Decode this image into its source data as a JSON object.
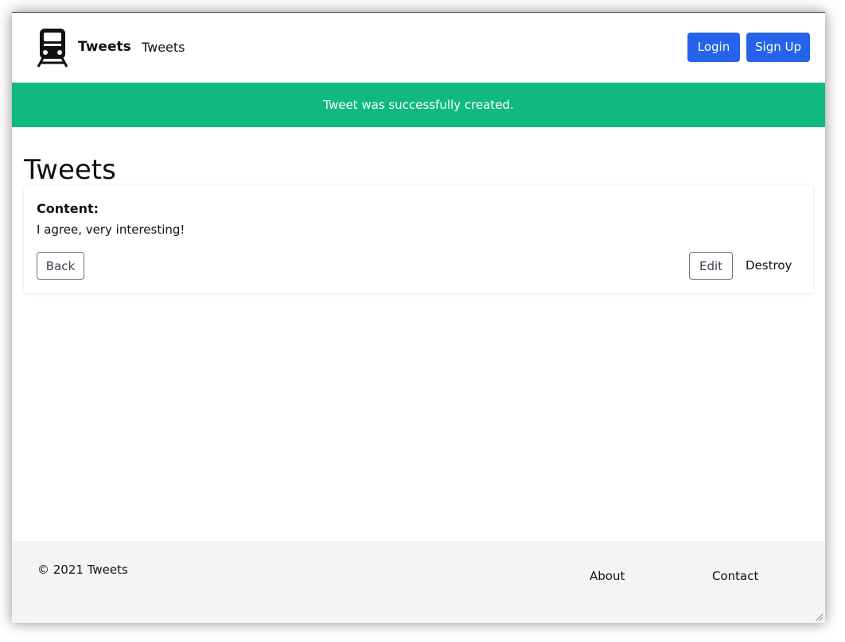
{
  "navbar": {
    "logo_icon": "train-icon",
    "brand": "Tweets",
    "link": "Tweets",
    "login_label": "Login",
    "signup_label": "Sign Up",
    "primary_color": "#2563eb"
  },
  "notice": {
    "text": "Tweet was successfully created.",
    "color": "#10b981"
  },
  "main": {
    "title": "Tweets",
    "card": {
      "label": "Content:",
      "value": "I agree, very interesting!",
      "back_label": "Back",
      "edit_label": "Edit",
      "destroy_label": "Destroy"
    }
  },
  "footer": {
    "copyright": "© 2021 Tweets",
    "about_label": "About",
    "contact_label": "Contact"
  }
}
